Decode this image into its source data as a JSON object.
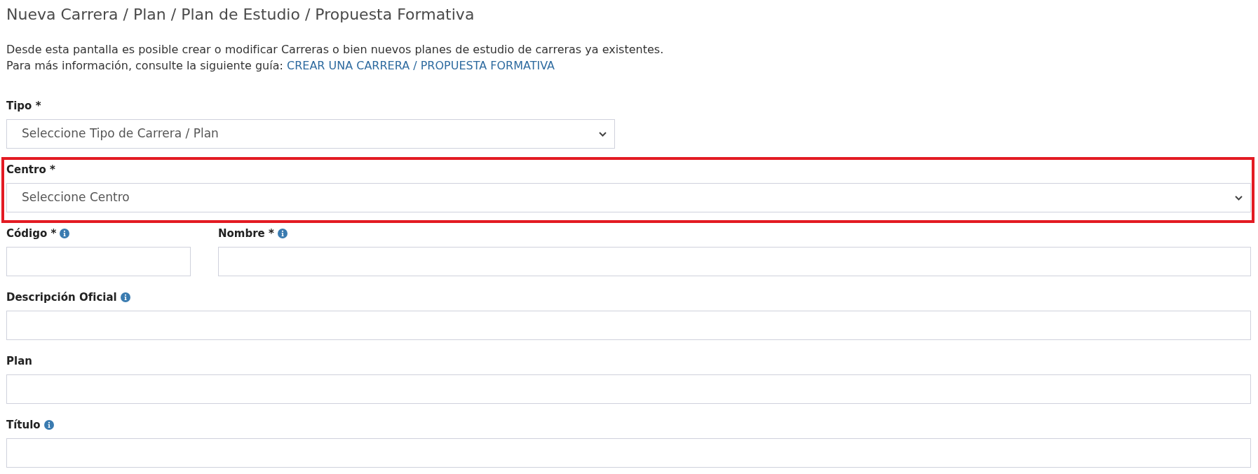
{
  "heading": "Nueva Carrera / Plan / Plan de Estudio / Propuesta Formativa",
  "intro": {
    "text": "Desde esta pantalla es posible crear o modificar Carreras o bien nuevos planes de estudio de carreras ya existentes.",
    "guide_text": "Para más información, consulte la siguiente guía:",
    "guide_link": "CREAR UNA CARRERA / PROPUESTA FORMATIVA"
  },
  "form_rows": [
    {
      "fields": [
        {
          "kind": "select",
          "label": "Tipo *",
          "value": "Seleccione Tipo de Carrera / Plan",
          "info": false,
          "highlighted": false
        }
      ]
    },
    {
      "fields": [
        {
          "kind": "select",
          "label": "Centro *",
          "value": "Seleccione Centro",
          "info": false,
          "highlighted": true
        }
      ]
    },
    {
      "fields": [
        {
          "kind": "text",
          "label": "Código *",
          "info": true,
          "highlighted": false
        },
        {
          "kind": "text",
          "label": "Nombre *",
          "info": true,
          "highlighted": false
        }
      ]
    },
    {
      "fields": [
        {
          "kind": "text",
          "label": "Descripción Oficial",
          "info": true,
          "highlighted": false
        }
      ]
    },
    {
      "fields": [
        {
          "kind": "text",
          "label": "Plan",
          "info": false,
          "highlighted": false
        }
      ]
    },
    {
      "fields": [
        {
          "kind": "text",
          "label": "Título",
          "info": true,
          "highlighted": false
        }
      ]
    }
  ]
}
